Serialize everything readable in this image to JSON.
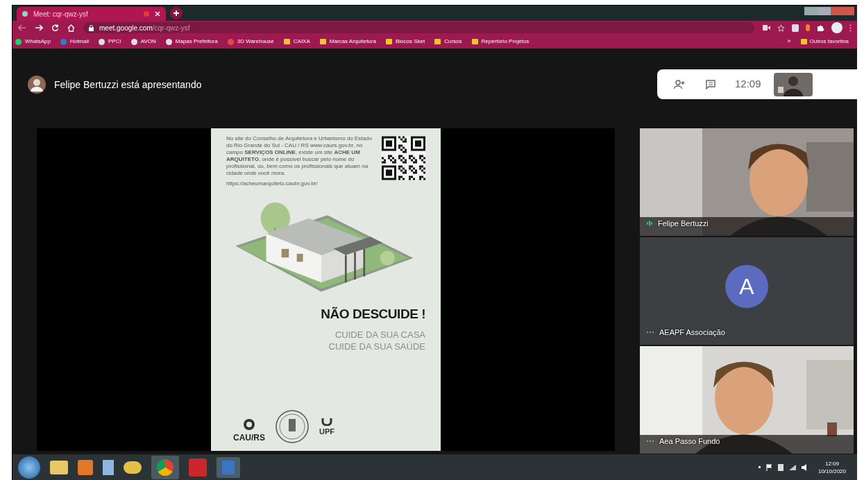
{
  "browser": {
    "tab": {
      "title": "Meet: cqr-qwz-ysf"
    },
    "address": {
      "host": "meet.google.com",
      "path": "/cqr-qwz-ysf"
    },
    "bookmarks": [
      {
        "label": "WhatsApp",
        "kind": "site",
        "color": "#25d366"
      },
      {
        "label": "Hotmail",
        "kind": "site",
        "color": "#2b7cd3"
      },
      {
        "label": "PPCI",
        "kind": "site",
        "color": "#e0e0e0"
      },
      {
        "label": "AVON",
        "kind": "site",
        "color": "#e0e0e0"
      },
      {
        "label": "Mapas Prefeitura",
        "kind": "site",
        "color": "#e0e0e0"
      },
      {
        "label": "3D Warehouse",
        "kind": "site",
        "color": "#e34b4b"
      },
      {
        "label": "CAIXA",
        "kind": "folder"
      },
      {
        "label": "Marcas Arquitetura",
        "kind": "folder"
      },
      {
        "label": "Blocos Sket",
        "kind": "folder"
      },
      {
        "label": "Cursos",
        "kind": "folder"
      },
      {
        "label": "Repertório Projetos",
        "kind": "folder"
      }
    ],
    "overflow_chevron": "»",
    "other_bookmarks": "Outros favoritos"
  },
  "meet": {
    "presenter_banner": "Felipe Bertuzzi está apresentando",
    "clock": "12:09",
    "slide": {
      "paragraph": "No site do Conselho de Arquitetura e Urbanismo do Estado do Rio Grande do Sul - CAU / RS www.caurs.gov.br, no campo **SERVIÇOS ONLINE**, existe um site **ACHE UM ARQUITETO**, onde é possível buscar pelo nome do profissional, ou, bem como os profissionais que atuam na cidade onde você mora.",
      "url": "https://acheumarquiteto.caubr.gov.br/",
      "heading": "NÃO DESCUIDE !",
      "lines": [
        "CUIDE DA SUA CASA",
        "CUIDE DA SUA SAÚDE"
      ],
      "logos": [
        "CAU/RS",
        "UPF"
      ]
    },
    "participants": [
      {
        "name": "Felipe Bertuzzi",
        "kind": "video",
        "speaking": true
      },
      {
        "name": "AEAPF Associação",
        "kind": "avatar",
        "initial": "A",
        "speaking": false
      },
      {
        "name": "Aea Passo Fundo",
        "kind": "video",
        "speaking": false
      }
    ]
  },
  "taskbar": {
    "time": "12:09",
    "date": "10/10/2020"
  }
}
